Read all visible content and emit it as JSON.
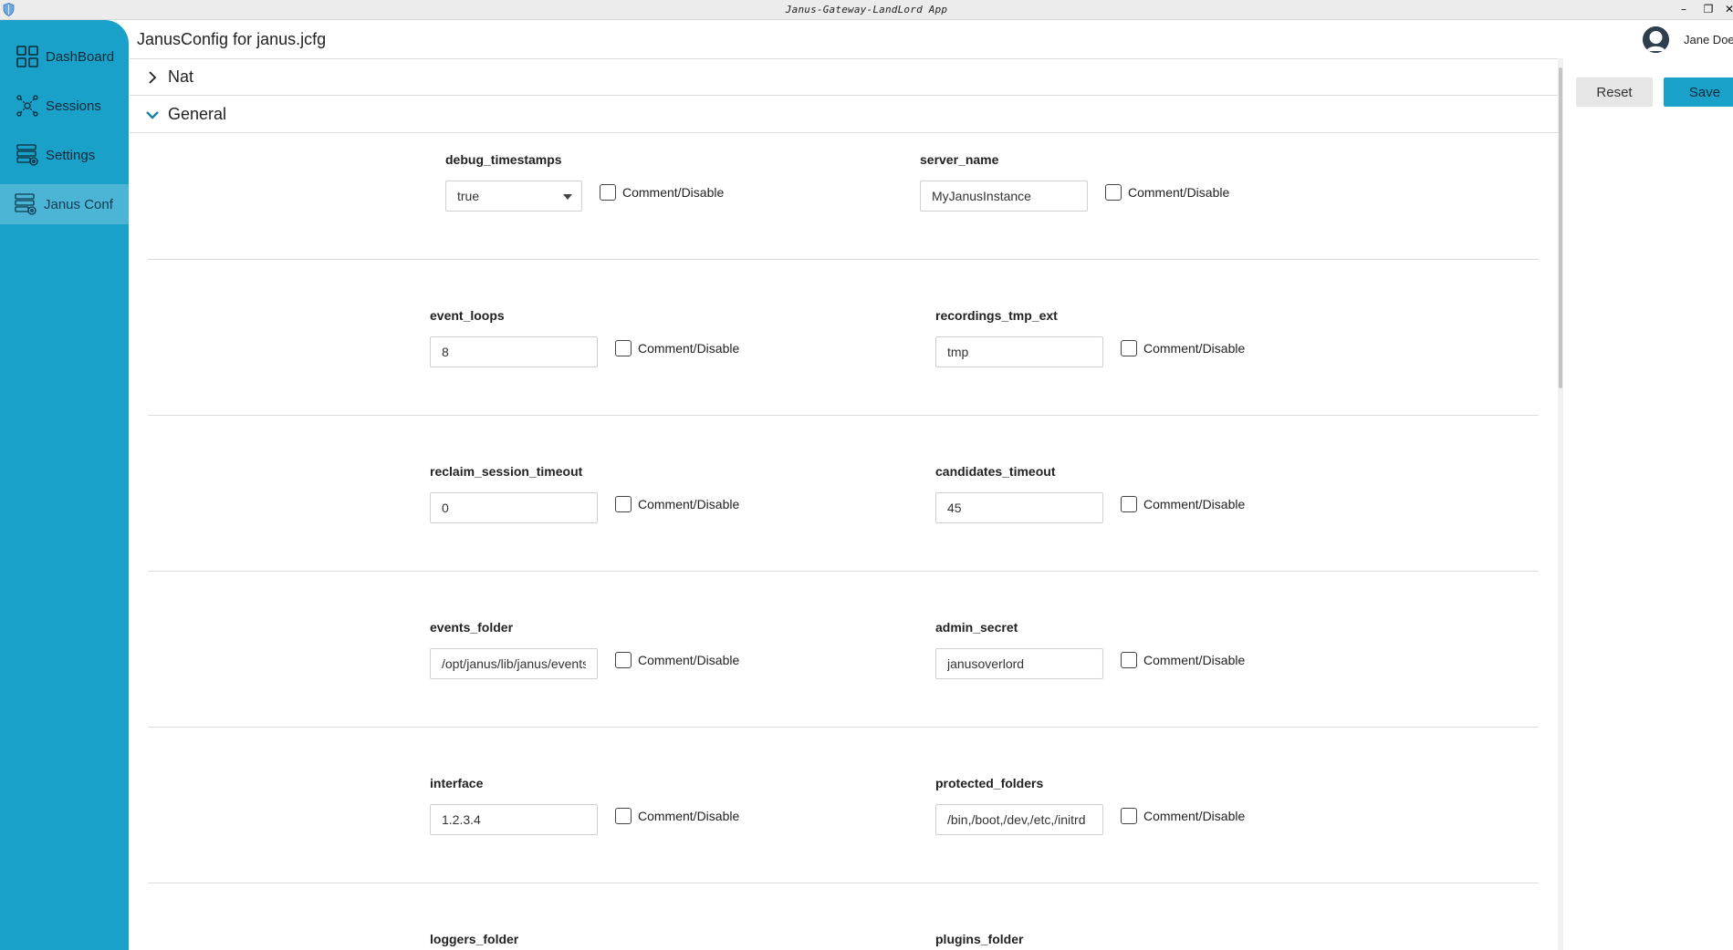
{
  "window": {
    "title": "Janus-Gateway-LandLord App",
    "minimize": "–",
    "restore": "❐",
    "close": "✕"
  },
  "sidebar": {
    "items": [
      {
        "label": "DashBoard",
        "icon": "dashboard-icon"
      },
      {
        "label": "Sessions",
        "icon": "sessions-icon"
      },
      {
        "label": "Settings",
        "icon": "settings-icon"
      },
      {
        "label": "Janus Conf",
        "icon": "janus-conf-icon",
        "active": true
      }
    ]
  },
  "header": {
    "title": "JanusConfig for janus.jcfg",
    "user_name": "Jane Doe"
  },
  "actions": {
    "reset_label": "Reset",
    "save_label": "Save"
  },
  "sections": {
    "nat": {
      "label": "Nat",
      "expanded": false
    },
    "general": {
      "label": "General",
      "expanded": true
    }
  },
  "comment_label": "Comment/Disable",
  "fields": {
    "debug_timestamps": {
      "label": "debug_timestamps",
      "value": "true",
      "type": "select"
    },
    "server_name": {
      "label": "server_name",
      "value": "MyJanusInstance"
    },
    "event_loops": {
      "label": "event_loops",
      "value": "8"
    },
    "recordings_tmp_ext": {
      "label": "recordings_tmp_ext",
      "value": "tmp"
    },
    "reclaim_session_timeout": {
      "label": "reclaim_session_timeout",
      "value": "0"
    },
    "candidates_timeout": {
      "label": "candidates_timeout",
      "value": "45"
    },
    "events_folder": {
      "label": "events_folder",
      "value": "/opt/janus/lib/janus/events"
    },
    "admin_secret": {
      "label": "admin_secret",
      "value": "janusoverlord"
    },
    "interface": {
      "label": "interface",
      "value": "1.2.3.4"
    },
    "protected_folders": {
      "label": "protected_folders",
      "value": "/bin,/boot,/dev,/etc,/initrd"
    },
    "loggers_folder": {
      "label": "loggers_folder"
    },
    "plugins_folder": {
      "label": "plugins_folder"
    }
  },
  "colors": {
    "accent": "#1aa1c9",
    "sidebar_text": "#0b2a37",
    "divider": "#dcdcdc"
  }
}
